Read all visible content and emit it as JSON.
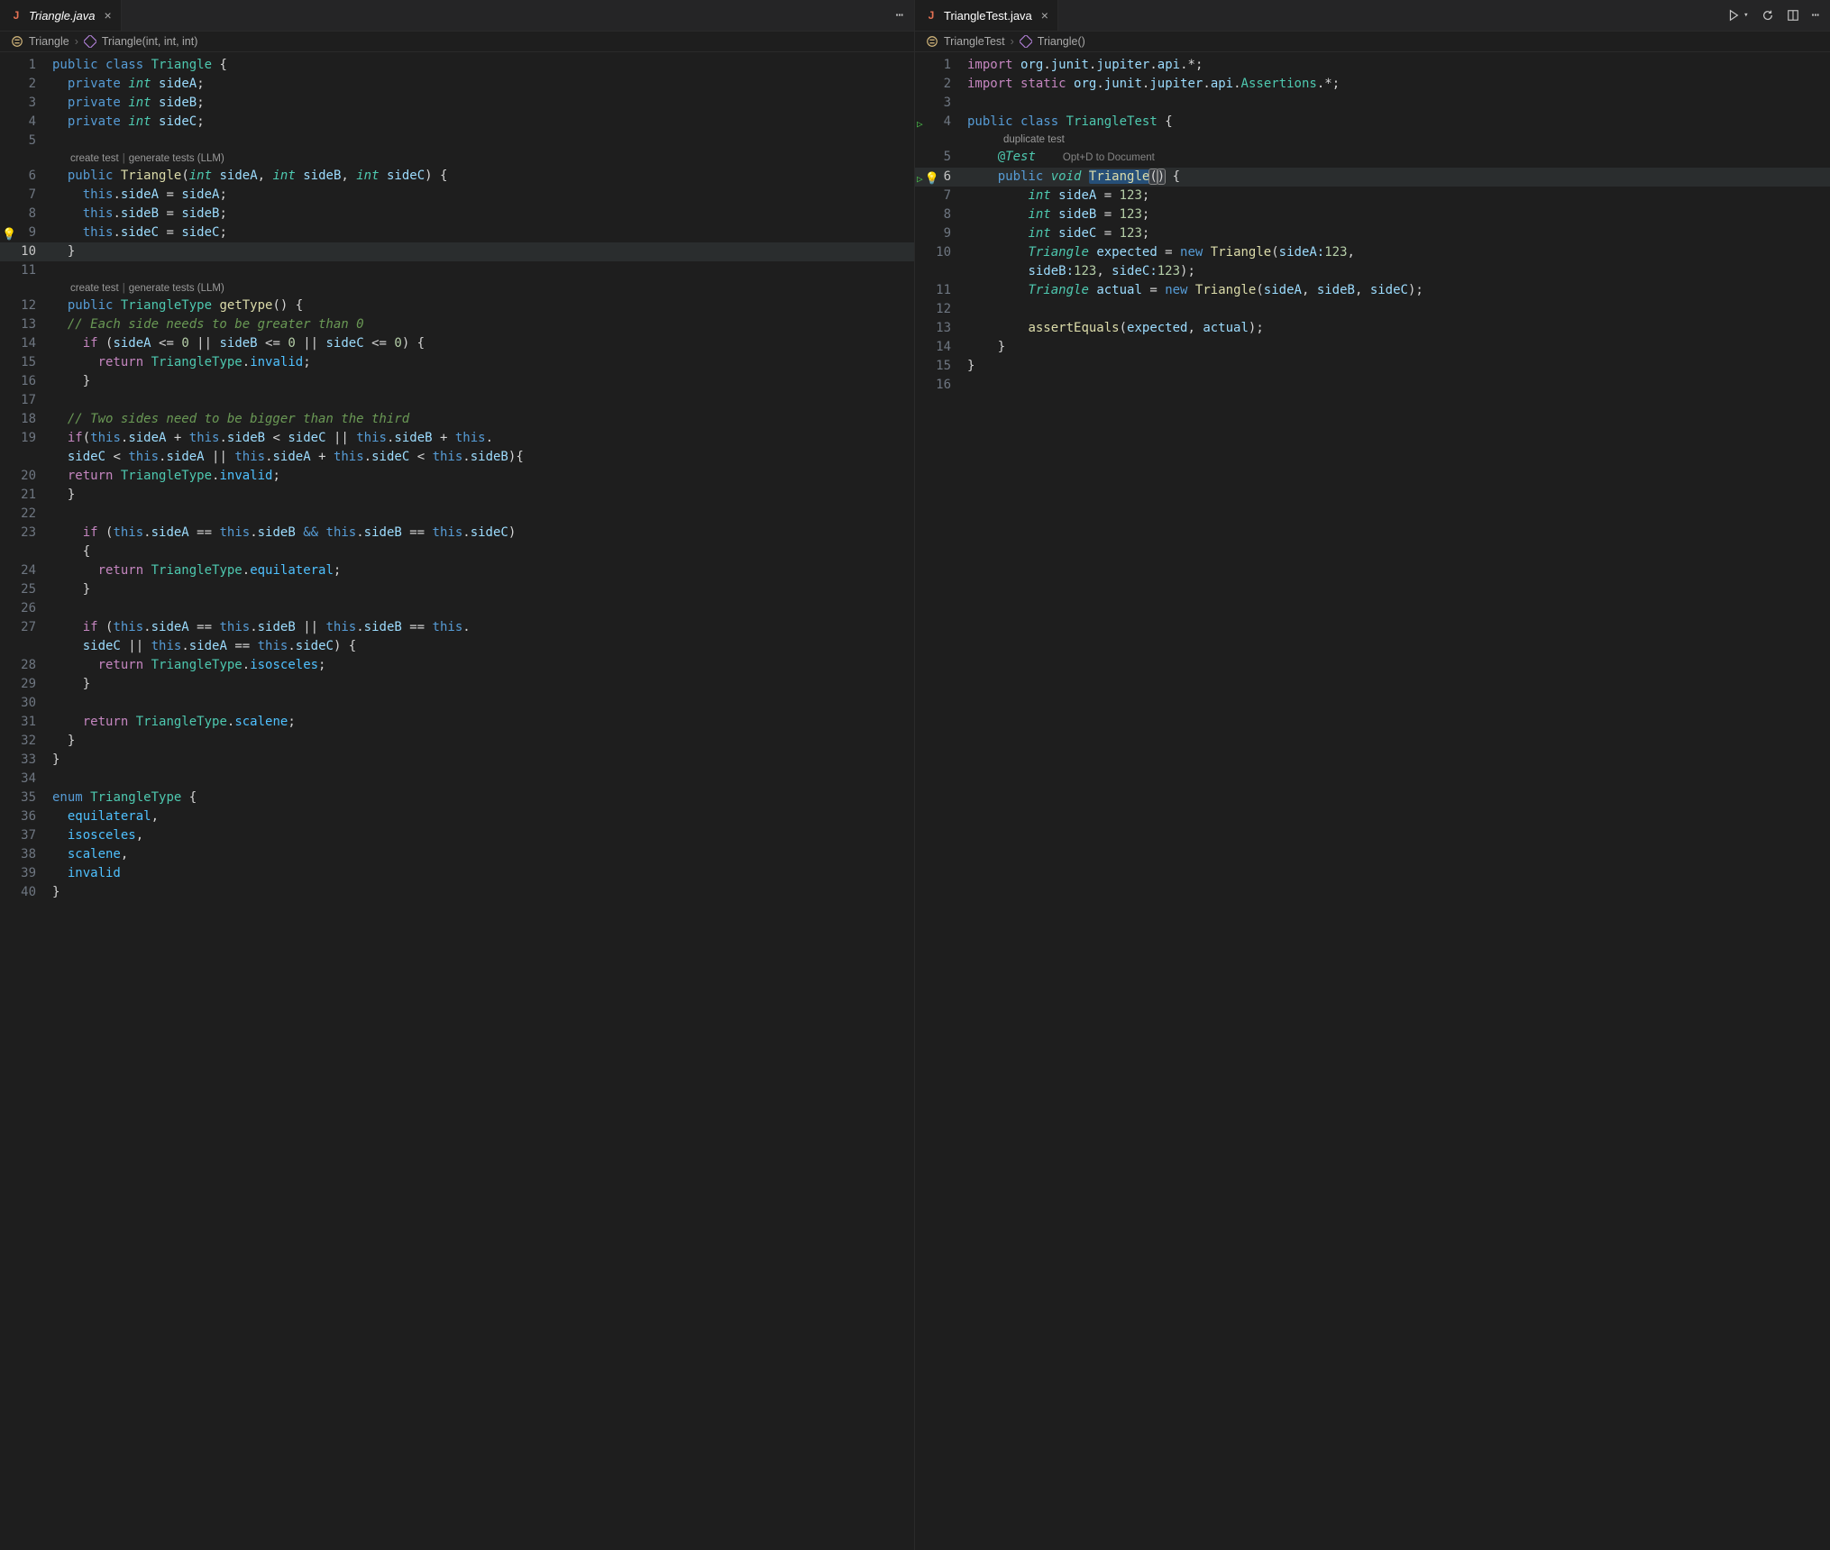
{
  "left": {
    "tab": {
      "filename": "Triangle.java"
    },
    "breadcrumb": {
      "items": [
        "Triangle",
        "Triangle(int, int, int)"
      ]
    },
    "codelens1": {
      "a": "create test",
      "b": "generate tests (LLM)"
    },
    "codelens2": {
      "a": "create test",
      "b": "generate tests (LLM)"
    },
    "lines": {
      "l1": "public class Triangle {",
      "l2": "  private int sideA;",
      "l3": "  private int sideB;",
      "l4": "  private int sideC;",
      "l5": "",
      "l6": "  public Triangle(int sideA, int sideB, int sideC) {",
      "l7": "    this.sideA = sideA;",
      "l8": "    this.sideB = sideB;",
      "l9": "    this.sideC = sideC;",
      "l10": "  }",
      "l11": "",
      "l12": "  public TriangleType getType() {",
      "l13": "  // Each side needs to be greater than 0",
      "l14": "    if (sideA <= 0 || sideB <= 0 || sideC <= 0) {",
      "l15": "      return TriangleType.invalid;",
      "l16": "    }",
      "l17": "",
      "l18": "  // Two sides need to be bigger than the third",
      "l19a": "  if(this.sideA + this.sideB < sideC || this.sideB + this.",
      "l19b": "  sideC < this.sideA || this.sideA + this.sideC < this.sideB){",
      "l20": "  return TriangleType.invalid;",
      "l21": "  }",
      "l22": "",
      "l23a": "    if (this.sideA == this.sideB && this.sideB == this.sideC)",
      "l23b": "    {",
      "l24": "      return TriangleType.equilateral;",
      "l25": "    }",
      "l26": "",
      "l27a": "    if (this.sideA == this.sideB || this.sideB == this.",
      "l27b": "    sideC || this.sideA == this.sideC) {",
      "l28": "      return TriangleType.isosceles;",
      "l29": "    }",
      "l30": "",
      "l31": "    return TriangleType.scalene;",
      "l32": "  }",
      "l33": "}",
      "l34": "",
      "l35": "enum TriangleType {",
      "l36": "  equilateral,",
      "l37": "  isosceles,",
      "l38": "  scalene,",
      "l39": "  invalid",
      "l40": "}"
    }
  },
  "right": {
    "tab": {
      "filename": "TriangleTest.java"
    },
    "breadcrumb": {
      "items": [
        "TriangleTest",
        "Triangle()"
      ]
    },
    "annotation_hint": "duplicate test",
    "doc_hint": "Opt+D to Document",
    "lines": {
      "l1": "import org.junit.jupiter.api.*;",
      "l2": "import static org.junit.jupiter.api.Assertions.*;",
      "l3": "",
      "l4": "public class TriangleTest {",
      "l5": "    @Test",
      "l6": "    public void Triangle() {",
      "l7": "        int sideA = 123;",
      "l8": "        int sideB = 123;",
      "l9": "        int sideC = 123;",
      "l10a": "        Triangle expected = new Triangle(sideA:123,",
      "l10b": "        sideB:123, sideC:123);",
      "l11": "        Triangle actual = new Triangle(sideA, sideB, sideC);",
      "l12": "",
      "l13": "        assertEquals(expected, actual);",
      "l14": "    }",
      "l15": "}",
      "l16": ""
    }
  }
}
